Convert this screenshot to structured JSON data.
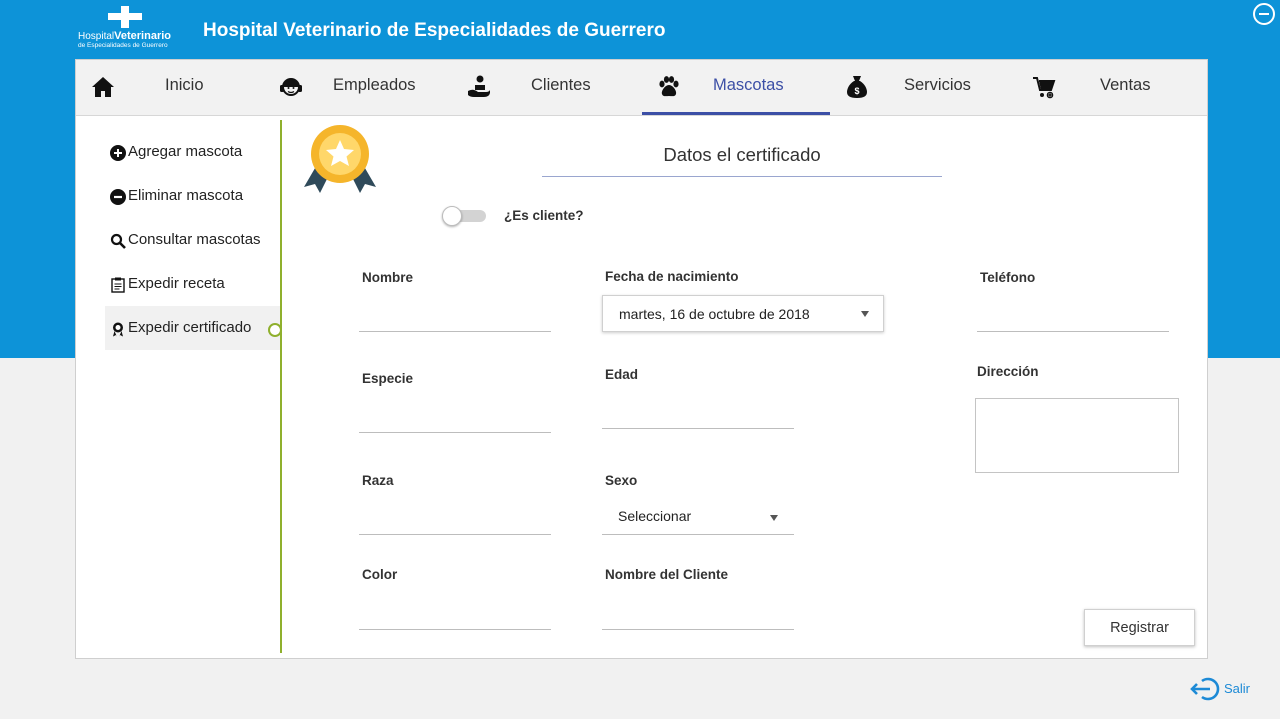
{
  "app": {
    "title": "Hospital Veterinario de Especialidades de Guerrero",
    "logo": {
      "line1_small": "Hospital",
      "line1_big": "Veterinario",
      "line2": "de Especialidades de Guerrero"
    }
  },
  "nav": {
    "items": [
      {
        "label": "Inicio",
        "icon": "home-icon"
      },
      {
        "label": "Empleados",
        "icon": "headset-person-icon"
      },
      {
        "label": "Clientes",
        "icon": "client-hand-icon"
      },
      {
        "label": "Mascotas",
        "icon": "paw-icon",
        "active": true
      },
      {
        "label": "Servicios",
        "icon": "money-bag-icon"
      },
      {
        "label": "Ventas",
        "icon": "cart-add-icon"
      }
    ]
  },
  "sidebar": {
    "items": [
      {
        "label": "Agregar mascota",
        "icon": "plus-circle-icon"
      },
      {
        "label": "Eliminar mascota",
        "icon": "minus-circle-icon"
      },
      {
        "label": "Consultar mascotas",
        "icon": "search-icon"
      },
      {
        "label": "Expedir receta",
        "icon": "prescription-icon"
      },
      {
        "label": "Expedir certificado",
        "icon": "certificate-icon",
        "active": true
      }
    ]
  },
  "form": {
    "title": "Datos el certificado",
    "is_client_label": "¿Es cliente?",
    "is_client": false,
    "labels": {
      "nombre": "Nombre",
      "especie": "Especie",
      "raza": "Raza",
      "color": "Color",
      "fecha_nacimiento": "Fecha de nacimiento",
      "edad": "Edad",
      "sexo": "Sexo",
      "nombre_cliente": "Nombre del Cliente",
      "telefono": "Teléfono",
      "direccion": "Dirección"
    },
    "values": {
      "nombre": "",
      "especie": "",
      "raza": "",
      "color": "",
      "edad": "",
      "nombre_cliente": "",
      "telefono": "",
      "direccion": "",
      "fecha_nacimiento": "martes, 16 de octubre de 2018",
      "sexo": "Seleccionar"
    },
    "register_label": "Registrar"
  },
  "footer": {
    "logout_label": "Salir"
  },
  "colors": {
    "header_blue": "#0d93d8",
    "active_tab": "#3c4fa6",
    "sidebar_accent": "#8fb02d",
    "logout": "#1d8ad6"
  }
}
